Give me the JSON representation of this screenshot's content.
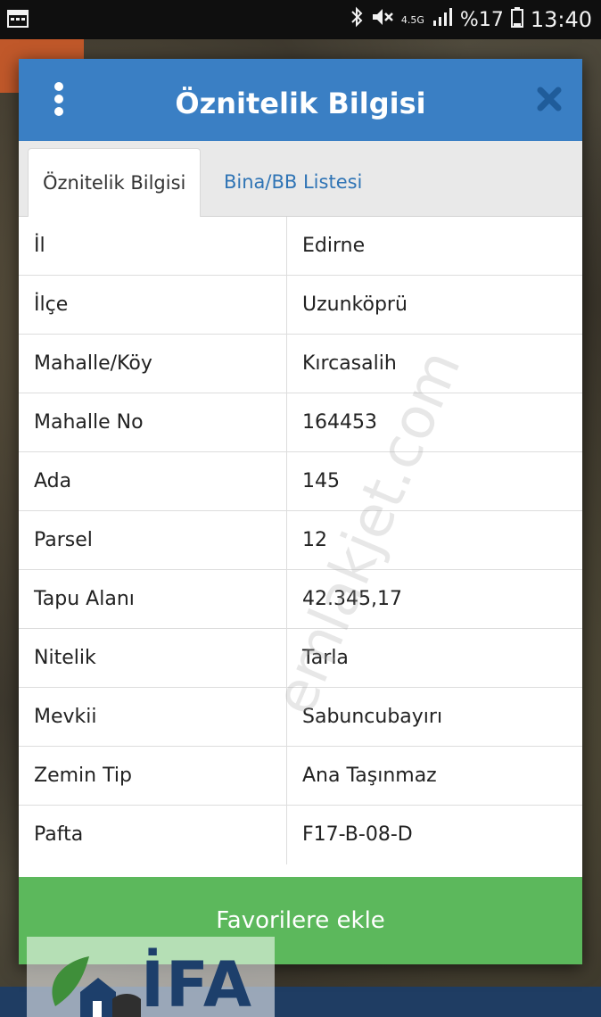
{
  "status_bar": {
    "network": "4.5G",
    "battery": "%17",
    "time": "13:40"
  },
  "dialog": {
    "title": "Öznitelik Bilgisi",
    "tabs": [
      {
        "label": "Öznitelik Bilgisi",
        "active": true
      },
      {
        "label": "Bina/BB Listesi",
        "active": false
      }
    ],
    "rows": [
      {
        "key": "İl",
        "value": "Edirne"
      },
      {
        "key": "İlçe",
        "value": "Uzunköprü"
      },
      {
        "key": "Mahalle/Köy",
        "value": "Kırcasalih"
      },
      {
        "key": "Mahalle No",
        "value": "164453"
      },
      {
        "key": "Ada",
        "value": "145"
      },
      {
        "key": "Parsel",
        "value": "12"
      },
      {
        "key": "Tapu Alanı",
        "value": "42.345,17"
      },
      {
        "key": "Nitelik",
        "value": "Tarla"
      },
      {
        "key": "Mevkii",
        "value": "Sabuncubayırı"
      },
      {
        "key": "Zemin Tip",
        "value": "Ana Taşınmaz"
      },
      {
        "key": "Pafta",
        "value": "F17-B-08-D"
      }
    ],
    "favorite_button": "Favorilere ekle"
  },
  "watermark": "emlakjet.com",
  "logo_text": "İFA",
  "colors": {
    "header": "#3a7fc4",
    "tab_link": "#2f74b5",
    "favorite_button": "#5cb85c",
    "status_bar": "#0f0f0f"
  },
  "icons": [
    "calendar-icon",
    "bluetooth-icon",
    "mute-icon",
    "signal-icon",
    "battery-icon",
    "menu-dots-icon",
    "close-icon",
    "house-leaf-icon"
  ]
}
